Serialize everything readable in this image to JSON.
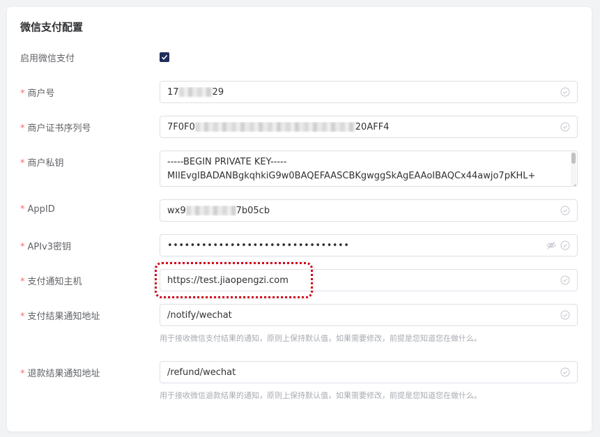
{
  "panel": {
    "title": "微信支付配置"
  },
  "fields": {
    "enable": {
      "label": "启用微信支付",
      "checked": true
    },
    "merchant_id": {
      "label": "商户号",
      "value_prefix": "17",
      "value_suffix": "29"
    },
    "cert_serial": {
      "label": "商户证书序列号",
      "value_prefix": "7F0F0",
      "value_suffix": "20AFF4"
    },
    "private_key": {
      "label": "商户私钥",
      "line1": "-----BEGIN PRIVATE KEY-----",
      "line2": "MIIEvgIBADANBgkqhkiG9w0BAQEFAASCBKgwggSkAgEAAoIBAQCx44awjo7pKHL+"
    },
    "app_id": {
      "label": "AppID",
      "value_prefix": "wx9",
      "value_suffix": "7b05cb"
    },
    "apiv3_key": {
      "label": "APIv3密钥",
      "masked_value": "••••••••••••••••••••••••••••••••"
    },
    "notify_host": {
      "label": "支付通知主机",
      "value": "https://test.jiaopengzi.com"
    },
    "pay_notify_url": {
      "label": "支付结果通知地址",
      "value": "/notify/wechat",
      "help": "用于接收微信支付结果的通知，原则上保持默认值，如果需要修改，前提是您知道您在做什么。"
    },
    "refund_notify_url": {
      "label": "退款结果通知地址",
      "value": "/refund/wechat",
      "help": "用于接收微信退款结果的通知，原则上保持默认值，如果需要修改，前提是您知道您在做什么。"
    }
  },
  "required_mark": "*",
  "colors": {
    "required": "#f56c6c",
    "checkbox": "#1f2d5a",
    "highlight": "#d0021b"
  }
}
